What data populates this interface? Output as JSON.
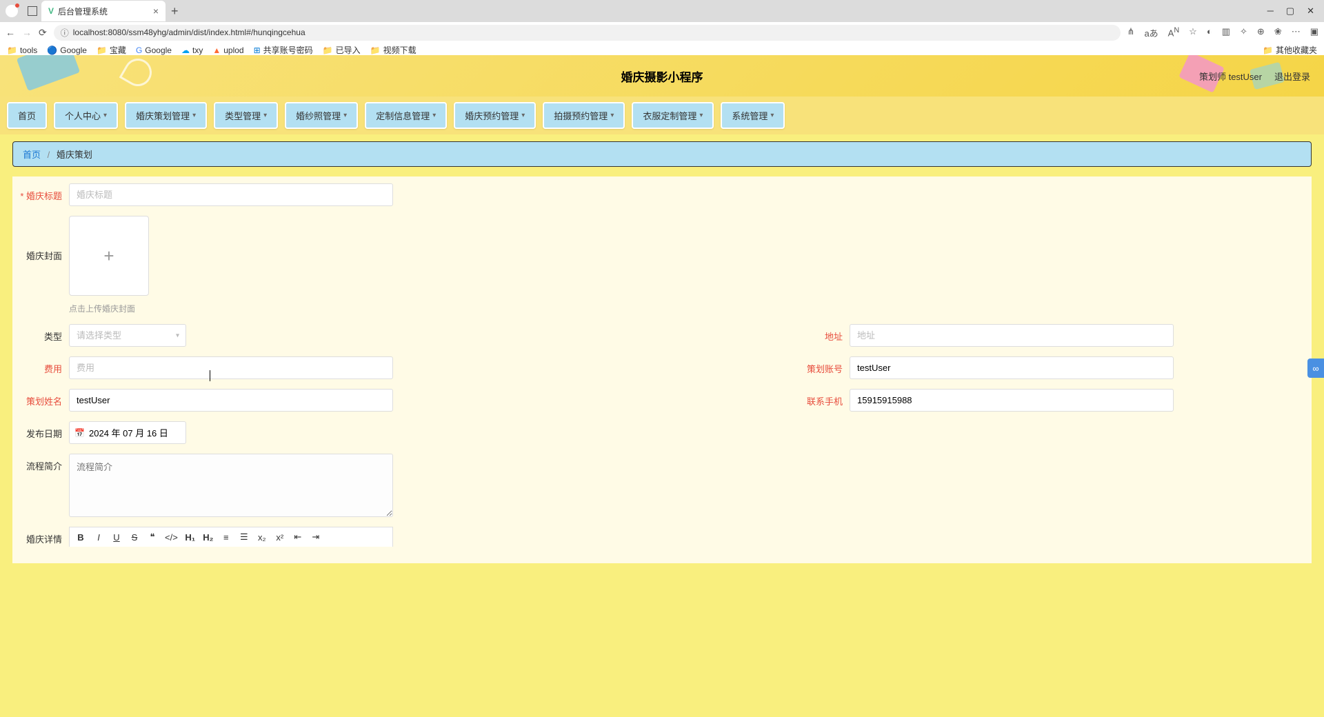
{
  "browser": {
    "tab_title": "后台管理系统",
    "url": "localhost:8080/ssm48yhg/admin/dist/index.html#/hunqingcehua",
    "bookmarks": [
      "tools",
      "Google",
      "宝藏",
      "Google",
      "txy",
      "uplod",
      "共享账号密码",
      "已导入",
      "视频下载"
    ],
    "other_bookmarks": "其他收藏夹"
  },
  "header": {
    "title": "婚庆摄影小程序",
    "user_label": "策划师 testUser",
    "logout": "退出登录"
  },
  "nav": {
    "items": [
      "首页",
      "个人中心",
      "婚庆策划管理",
      "类型管理",
      "婚纱照管理",
      "定制信息管理",
      "婚庆预约管理",
      "拍摄预约管理",
      "衣服定制管理",
      "系统管理"
    ]
  },
  "breadcrumb": {
    "home": "首页",
    "current": "婚庆策划"
  },
  "form": {
    "title_label": "婚庆标题",
    "title_placeholder": "婚庆标题",
    "cover_label": "婚庆封面",
    "cover_tip": "点击上传婚庆封面",
    "type_label": "类型",
    "type_placeholder": "请选择类型",
    "address_label": "地址",
    "address_placeholder": "地址",
    "fee_label": "费用",
    "fee_placeholder": "费用",
    "plan_account_label": "策划账号",
    "plan_account_value": "testUser",
    "plan_name_label": "策划姓名",
    "plan_name_value": "testUser",
    "phone_label": "联系手机",
    "phone_value": "15915915988",
    "publish_date_label": "发布日期",
    "publish_date_value": "2024 年 07 月 16 日",
    "flow_label": "流程简介",
    "flow_placeholder": "流程简介",
    "detail_label": "婚庆详情"
  }
}
